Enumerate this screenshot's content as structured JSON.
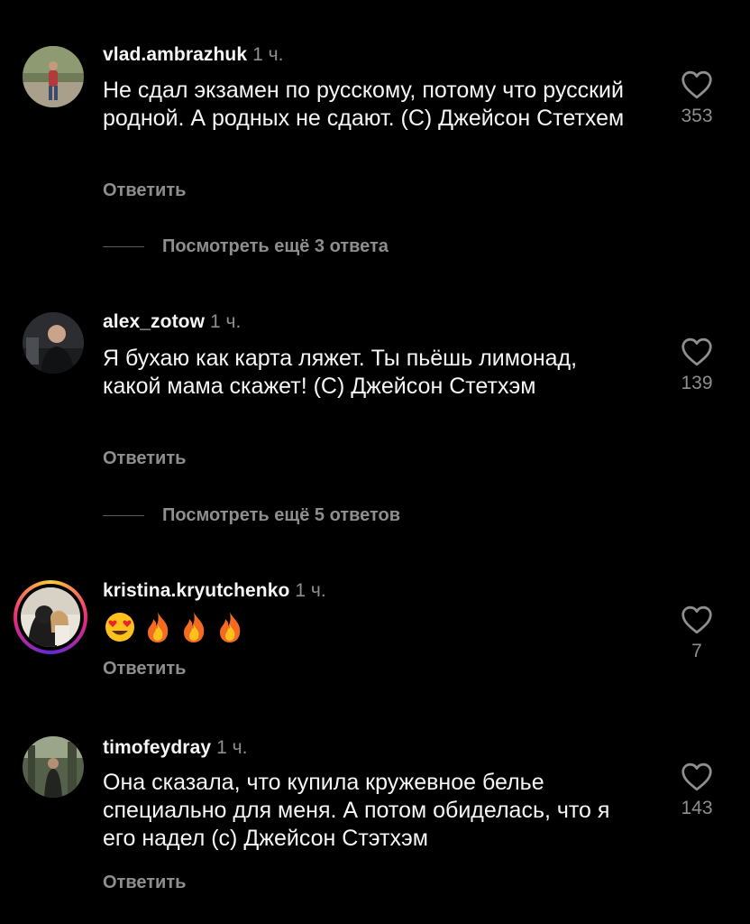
{
  "comments": [
    {
      "username": "vlad.ambrazhuk",
      "time": "1 ч.",
      "text": "Не сдал экзамен по русскому, потому что русский родной. А родных не сдают. (С) Джейсон Стетхем",
      "reply_label": "Ответить",
      "likes": "353",
      "view_more": "Посмотреть ещё 3 ответа"
    },
    {
      "username": "alex_zotow",
      "time": "1 ч.",
      "text": "Я бухаю как карта ляжет. Ты пьёшь лимонад, какой мама скажет! (С) Джейсон Стетхэм",
      "reply_label": "Ответить",
      "likes": "139",
      "view_more": "Посмотреть ещё 5 ответов"
    },
    {
      "username": "kristina.kryutchenko",
      "time": "1 ч.",
      "emojis": [
        "heart-eyes-emoji",
        "fire-emoji",
        "fire-emoji",
        "fire-emoji"
      ],
      "reply_label": "Ответить",
      "likes": "7"
    },
    {
      "username": "timofeydray",
      "time": "1 ч.",
      "text": "Она сказала, что купила кружевное белье специально для меня. А потом обиделась, что я его надел (с) Джейсон Стэтхэм",
      "reply_label": "Ответить",
      "likes": "143"
    }
  ],
  "colors": {
    "background": "#000000",
    "primary_text": "#f5f5f5",
    "secondary_text": "#8e8e8e",
    "story_ring": [
      "#f9ce34",
      "#ee2a7b",
      "#6228d7"
    ]
  },
  "icons": {
    "like": "heart-outline-icon"
  }
}
